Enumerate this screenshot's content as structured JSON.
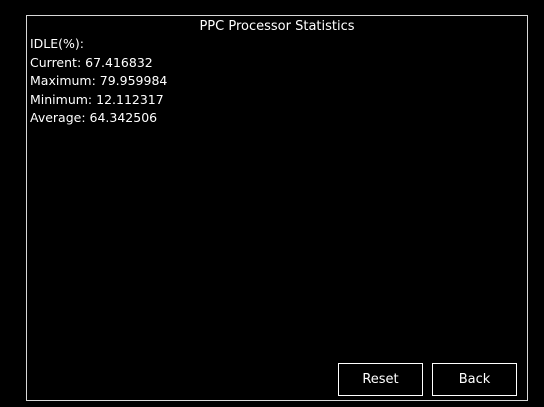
{
  "window": {
    "title": "PPC Processor Statistics"
  },
  "stats": {
    "header": "IDLE(%):",
    "current": "Current: 67.416832",
    "maximum": "Maximum: 79.959984",
    "minimum": "Minimum: 12.112317",
    "average": "Average: 64.342506"
  },
  "buttons": {
    "reset_label": "Reset",
    "back_label": "Back"
  },
  "colors": {
    "background": "#000000",
    "foreground": "#ffffff",
    "border": "#d8d8d8"
  }
}
